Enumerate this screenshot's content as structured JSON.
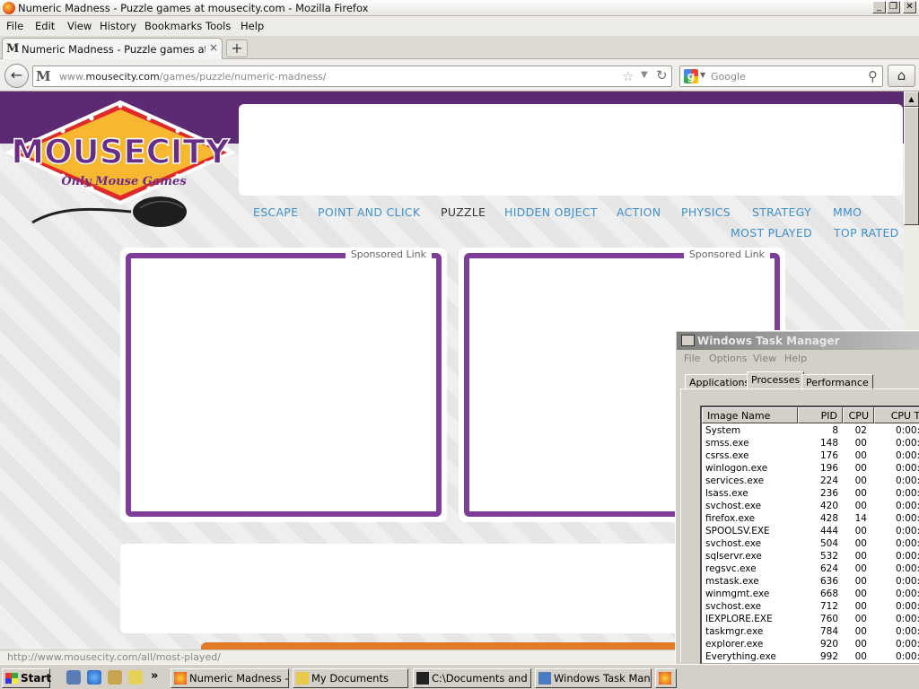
{
  "window": {
    "title": "Numeric Madness - Puzzle games at mousecity.com - Mozilla Firefox",
    "controls": {
      "minimize": "_",
      "maximize": "❐",
      "close": "✕"
    }
  },
  "menubar": [
    "File",
    "Edit",
    "View",
    "History",
    "Bookmarks",
    "Tools",
    "Help"
  ],
  "tab": {
    "label": "Numeric Madness - Puzzle games at mouseci...",
    "close": "×",
    "favicon": "M"
  },
  "newtab_label": "+",
  "navbar": {
    "back_icon": "back-arrow-icon",
    "site_icon_letter": "M",
    "url_prefix": "www.",
    "url_domain": "mousecity.com",
    "url_path": "/games/puzzle/numeric-madness/",
    "search_placeholder": "Google",
    "search_engine_letter": "g"
  },
  "page": {
    "logo": {
      "text": "MOUSECITY",
      "tagline": "Only Mouse Games"
    },
    "nav_row1": [
      "ESCAPE",
      "POINT AND CLICK",
      "PUZZLE",
      "HIDDEN OBJECT",
      "ACTION",
      "PHYSICS",
      "STRATEGY",
      "MMO"
    ],
    "nav_row2": [
      "MOST PLAYED",
      "TOP RATED"
    ],
    "active_nav": "PUZZLE",
    "sponsored_label": "Sponsored Link",
    "status_link": "http://www.mousecity.com/all/most-played/"
  },
  "taskmgr": {
    "title": "Windows Task Manager",
    "menu": [
      "File",
      "Options",
      "View",
      "Help"
    ],
    "tabs": [
      "Applications",
      "Processes",
      "Performance"
    ],
    "active_tab": "Processes",
    "columns": [
      "Image Name",
      "PID",
      "CPU",
      "CPU Ti"
    ],
    "rows": [
      {
        "name": "System",
        "pid": "8",
        "cpu": "02",
        "time": "0:00:"
      },
      {
        "name": "smss.exe",
        "pid": "148",
        "cpu": "00",
        "time": "0:00:"
      },
      {
        "name": "csrss.exe",
        "pid": "176",
        "cpu": "00",
        "time": "0:00:"
      },
      {
        "name": "winlogon.exe",
        "pid": "196",
        "cpu": "00",
        "time": "0:00:"
      },
      {
        "name": "services.exe",
        "pid": "224",
        "cpu": "00",
        "time": "0:00:"
      },
      {
        "name": "lsass.exe",
        "pid": "236",
        "cpu": "00",
        "time": "0:00:"
      },
      {
        "name": "svchost.exe",
        "pid": "420",
        "cpu": "00",
        "time": "0:00:"
      },
      {
        "name": "firefox.exe",
        "pid": "428",
        "cpu": "14",
        "time": "0:00:"
      },
      {
        "name": "SPOOLSV.EXE",
        "pid": "444",
        "cpu": "00",
        "time": "0:00:"
      },
      {
        "name": "svchost.exe",
        "pid": "504",
        "cpu": "00",
        "time": "0:00:"
      },
      {
        "name": "sqlservr.exe",
        "pid": "532",
        "cpu": "00",
        "time": "0:00:"
      },
      {
        "name": "regsvc.exe",
        "pid": "624",
        "cpu": "00",
        "time": "0:00:"
      },
      {
        "name": "mstask.exe",
        "pid": "636",
        "cpu": "00",
        "time": "0:00:"
      },
      {
        "name": "winmgmt.exe",
        "pid": "668",
        "cpu": "00",
        "time": "0:00:"
      },
      {
        "name": "svchost.exe",
        "pid": "712",
        "cpu": "00",
        "time": "0:00:"
      },
      {
        "name": "IEXPLORE.EXE",
        "pid": "760",
        "cpu": "00",
        "time": "0:00:"
      },
      {
        "name": "taskmgr.exe",
        "pid": "784",
        "cpu": "00",
        "time": "0:00:"
      },
      {
        "name": "explorer.exe",
        "pid": "920",
        "cpu": "00",
        "time": "0:00:"
      },
      {
        "name": "Everything.exe",
        "pid": "992",
        "cpu": "00",
        "time": "0:00:"
      }
    ]
  },
  "taskbar": {
    "start": "Start",
    "quicklaunch_more": "»",
    "buttons": [
      "Numeric Madness - ...",
      "My Documents",
      "C:\\Documents and ...",
      "Windows Task Man..."
    ]
  },
  "colors": {
    "brand_purple": "#7e3d99",
    "nav_link": "#3f8fc9",
    "logo_orange": "#f0a020"
  }
}
